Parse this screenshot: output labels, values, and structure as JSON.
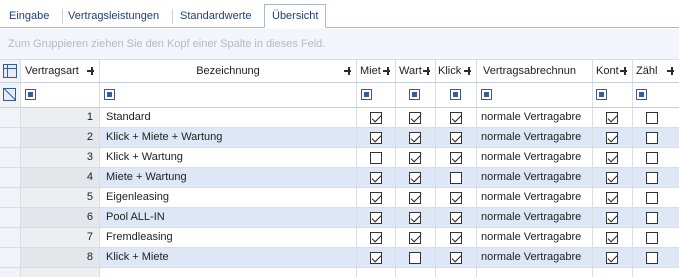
{
  "tabs": [
    {
      "label": "Eingabe",
      "active": false
    },
    {
      "label": "Vertragsleistungen",
      "active": false
    },
    {
      "label": "Standardwerte",
      "active": false
    },
    {
      "label": "Übersicht",
      "active": true
    }
  ],
  "group_panel": {
    "hint": "Zum Gruppieren ziehen Sie den Kopf einer Spalte in dieses Feld."
  },
  "grid": {
    "columns": {
      "vertragsart": "Vertragsart",
      "bezeichnung": "Bezeichnung",
      "miet": "Miet",
      "wart": "Wart",
      "klick": "Klick",
      "abrechnung": "Vertragsabrechnun",
      "kont": "Kont",
      "zaehl": "Zähl"
    },
    "rows": [
      {
        "nr": "1",
        "bezeichnung": "Standard",
        "miet": true,
        "wart": true,
        "klick": true,
        "abrechnung": "normale Vertragabre",
        "kont": true,
        "zaehl": false
      },
      {
        "nr": "2",
        "bezeichnung": "Klick + Miete + Wartung",
        "miet": true,
        "wart": true,
        "klick": true,
        "abrechnung": "normale Vertragabre",
        "kont": true,
        "zaehl": false
      },
      {
        "nr": "3",
        "bezeichnung": "Klick + Wartung",
        "miet": false,
        "wart": true,
        "klick": true,
        "abrechnung": "normale Vertragabre",
        "kont": true,
        "zaehl": false
      },
      {
        "nr": "4",
        "bezeichnung": "Miete + Wartung",
        "miet": true,
        "wart": true,
        "klick": false,
        "abrechnung": "normale Vertragabre",
        "kont": true,
        "zaehl": false
      },
      {
        "nr": "5",
        "bezeichnung": "Eigenleasing",
        "miet": true,
        "wart": true,
        "klick": true,
        "abrechnung": "normale Vertragabre",
        "kont": true,
        "zaehl": false
      },
      {
        "nr": "6",
        "bezeichnung": "Pool ALL-IN",
        "miet": true,
        "wart": true,
        "klick": true,
        "abrechnung": "normale Vertragabre",
        "kont": true,
        "zaehl": false
      },
      {
        "nr": "7",
        "bezeichnung": "Fremdleasing",
        "miet": true,
        "wart": true,
        "klick": true,
        "abrechnung": "normale Vertragabre",
        "kont": true,
        "zaehl": false
      },
      {
        "nr": "8",
        "bezeichnung": "Klick + Miete",
        "miet": true,
        "wart": false,
        "klick": true,
        "abrechnung": "normale Vertragabre",
        "kont": true,
        "zaehl": false
      }
    ]
  },
  "colors": {
    "accent": "#3a5a9a",
    "row_alt": "#dde7f6",
    "grid_line": "#d7dde7"
  }
}
